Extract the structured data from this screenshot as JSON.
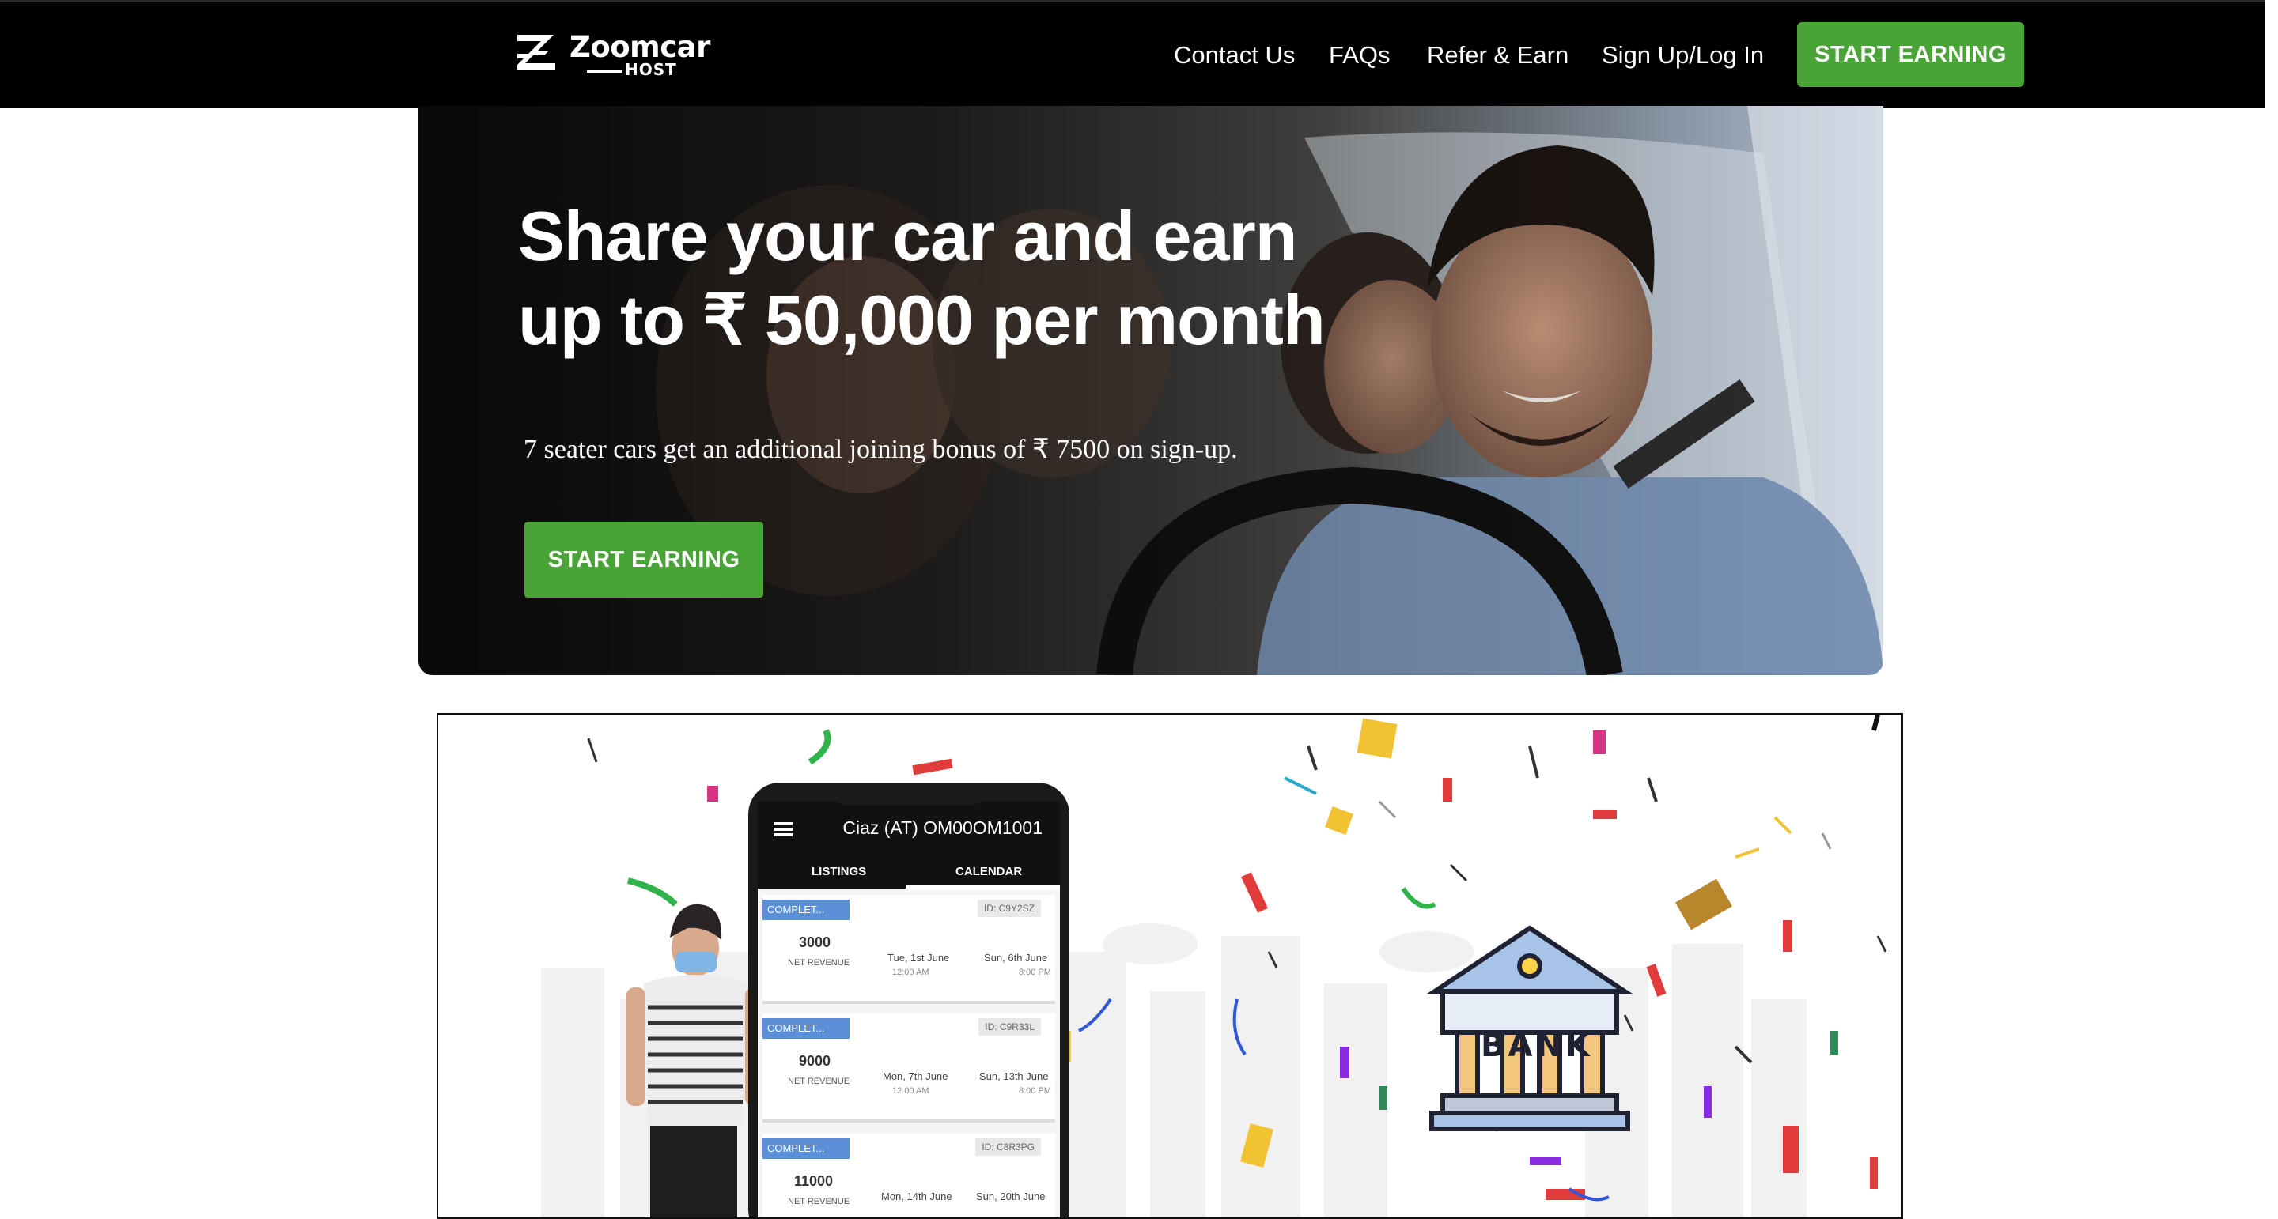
{
  "brand": {
    "name": "Zoomcar",
    "subtitle": "HOST"
  },
  "nav": {
    "links": [
      "Contact Us",
      "FAQs",
      "Refer & Earn",
      "Sign Up/Log In"
    ],
    "cta": "START EARNING"
  },
  "hero": {
    "title_line1": "Share your car and earn",
    "title_line2": "up to ₹ 50,000 per month",
    "subtitle": "7 seater cars get an additional joining bonus of ₹ 7500 on sign-up.",
    "cta": "START EARNING"
  },
  "promo": {
    "phone": {
      "title": "Ciaz (AT) OM00OM1001",
      "tabs": [
        "LISTINGS",
        "CALENDAR"
      ],
      "bookings": [
        {
          "status": "COMPLET...",
          "id": "ID: C9Y2SZ",
          "amount": "3000",
          "amount_label": "NET REVENUE",
          "start_date": "Tue, 1st June",
          "start_time": "12:00 AM",
          "end_date": "Sun, 6th June",
          "end_time": "8:00 PM"
        },
        {
          "status": "COMPLET...",
          "id": "ID: C9R33L",
          "amount": "9000",
          "amount_label": "NET REVENUE",
          "start_date": "Mon, 7th June",
          "start_time": "12:00 AM",
          "end_date": "Sun, 13th June",
          "end_time": "8:00 PM"
        },
        {
          "status": "COMPLET...",
          "id": "ID: C8R3PG",
          "amount": "11000",
          "amount_label": "NET REVENUE",
          "start_date": "Mon, 14th June",
          "start_time": "",
          "end_date": "Sun, 20th June",
          "end_time": ""
        }
      ]
    },
    "bank_label": "BANK"
  },
  "colors": {
    "brand_green": "#49a337",
    "nav_bg": "#000000",
    "tag_blue": "#5b8fd8"
  },
  "icons": {
    "logo": "zoomcar-z-logo",
    "menu": "hamburger-menu-icon",
    "bank": "bank-building-icon"
  }
}
